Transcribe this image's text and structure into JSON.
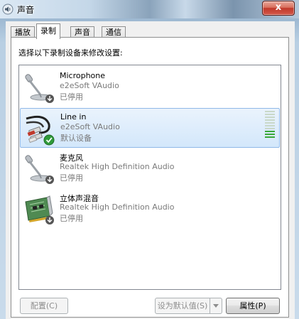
{
  "window": {
    "title": "声音",
    "close_label": "x"
  },
  "tabs": [
    {
      "label": "播放",
      "active": false
    },
    {
      "label": "录制",
      "active": true
    },
    {
      "label": "声音",
      "active": false
    },
    {
      "label": "通信",
      "active": false
    }
  ],
  "instruction": "选择以下录制设备来修改设置:",
  "devices": [
    {
      "name": "Microphone",
      "driver": "e2eSoft VAudio",
      "status": "已停用",
      "icon": "microphone-icon",
      "badge": "disabled-down-arrow",
      "selected": false
    },
    {
      "name": "Line in",
      "driver": "e2eSoft VAudio",
      "status": "默认设备",
      "icon": "line-in-cable-icon",
      "badge": "default-check",
      "selected": true,
      "level": 0.3
    },
    {
      "name": "麦克风",
      "driver": "Realtek High Definition Audio",
      "status": "已停用",
      "icon": "microphone-icon",
      "badge": "disabled-down-arrow",
      "selected": false
    },
    {
      "name": "立体声混音",
      "driver": "Realtek High Definition Audio",
      "status": "已停用",
      "icon": "sound-card-icon",
      "badge": "disabled-down-arrow",
      "selected": false
    }
  ],
  "buttons": {
    "configure": "配置(C)",
    "set_default": "设为默认值(S)",
    "properties": "属性(P)"
  },
  "colors": {
    "selection_bg": "#d3e7fb",
    "selection_border": "#8fb8e8",
    "level_on": "#3aa83a",
    "level_off": "#c9d8c9",
    "close_red": "#c0392b"
  }
}
